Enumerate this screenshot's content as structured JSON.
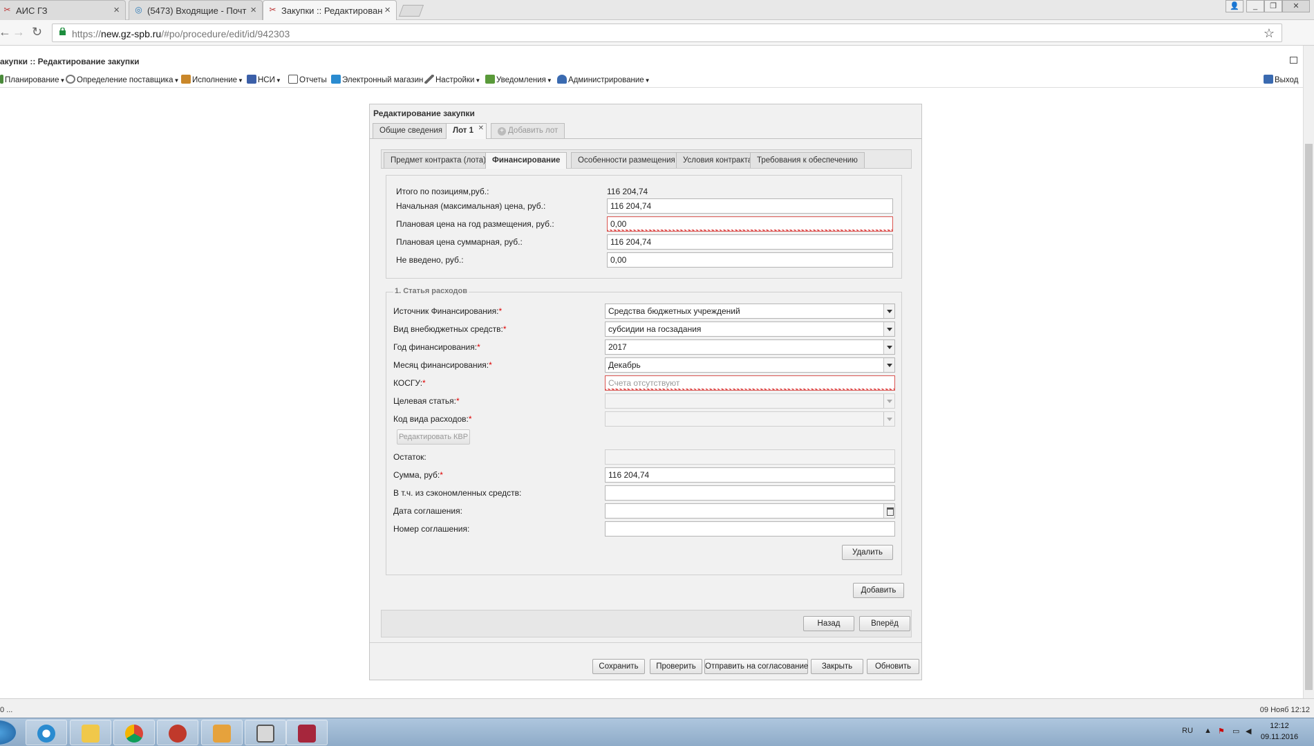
{
  "browser": {
    "tabs": [
      {
        "title": "АИС ГЗ",
        "icon": "ais-favicon"
      },
      {
        "title": "(5473) Входящие - Почт",
        "icon": "mail-favicon"
      },
      {
        "title": "Закупки :: Редактирован",
        "icon": "ais-favicon"
      }
    ],
    "url_scheme": "https://",
    "url_host": "new.gz-spb.ru",
    "url_path": "/#po/procedure/edit/id/942303"
  },
  "app": {
    "title": "акупки :: Редактирование закупки",
    "menu": [
      {
        "label": "Планирование",
        "icon": "planning-icon",
        "color": "#4a8a3a"
      },
      {
        "label": "Определение поставщика",
        "icon": "supplier-icon",
        "color": "#777777"
      },
      {
        "label": "Исполнение",
        "icon": "execution-icon",
        "color": "#c9872a"
      },
      {
        "label": "НСИ",
        "icon": "book-icon",
        "color": "#3b5fa8"
      },
      {
        "label": "Отчеты",
        "icon": "reports-icon",
        "color": "#555555"
      },
      {
        "label": "Электронный магазин",
        "icon": "cart-icon",
        "color": "#2a8bd0"
      },
      {
        "label": "Настройки",
        "icon": "wrench-icon",
        "color": "#666666"
      },
      {
        "label": "Уведомления",
        "icon": "notifications-icon",
        "color": "#5a9a3a"
      },
      {
        "label": "Администрирование",
        "icon": "admin-icon",
        "color": "#3a6ab0"
      }
    ],
    "logout": "Выход"
  },
  "window": {
    "title": "Редактирование закупки",
    "lot_tabs": [
      "Общие сведения",
      "Лот 1",
      "Добавить лот"
    ],
    "sub_tabs": [
      "Предмет контракта (лота)",
      "Финансирование",
      "Особенности размещения",
      "Условия контракта",
      "Требования к обеспечению"
    ],
    "active_sub_tab": "Финансирование"
  },
  "totals": {
    "items_total_label": "Итого по позициям,руб.:",
    "items_total_value": "116 204,74",
    "nmc_label": "Начальная (максимальная) цена, руб.:",
    "nmc_value": "116 204,74",
    "plan_year_label": "Плановая цена на год размещения, руб.:",
    "plan_year_value": "0,00",
    "plan_sum_label": "Плановая цена суммарная, руб.:",
    "plan_sum_value": "116 204,74",
    "not_entered_label": "Не введено, руб.:",
    "not_entered_value": "0,00"
  },
  "expenses": {
    "legend": "1. Статья расходов",
    "source_label": "Источник Финансирования:",
    "source_value": "Средства бюджетных учреждений",
    "kind_label": "Вид внебюджетных средств:",
    "kind_value": "субсидии на госзадания",
    "year_label": "Год финансирования:",
    "year_value": "2017",
    "month_label": "Месяц финансирования:",
    "month_value": "Декабрь",
    "kosgu_label": "КОСГУ:",
    "kosgu_placeholder": "Счета отсутствуют",
    "target_label": "Целевая статья:",
    "target_value": "",
    "kvr_label": "Код вида расходов:",
    "kvr_value": "",
    "edit_kvr_button": "Редактировать КВР",
    "rest_label": "Остаток:",
    "rest_value": "",
    "sum_label": "Сумма, руб:",
    "sum_value": "116 204,74",
    "saved_label": "В т.ч. из сэкономленных средств:",
    "saved_value": "",
    "agreement_date_label": "Дата соглашения:",
    "agreement_date_value": "",
    "agreement_number_label": "Номер соглашения:",
    "agreement_number_value": "",
    "delete_button": "Удалить",
    "required_mark": "*"
  },
  "actions": {
    "add": "Добавить",
    "back": "Назад",
    "forward": "Вперёд",
    "save": "Сохранить",
    "check": "Проверить",
    "send": "Отправить на согласование",
    "close": "Закрыть",
    "refresh": "Обновить"
  },
  "status": {
    "left": "0 ...",
    "right": "09 Нояб 12:12"
  },
  "taskbar": {
    "lang": "RU",
    "time": "12:12",
    "date": "09.11.2016"
  },
  "colors": {
    "error": "#d9534f",
    "required": "#dd0000",
    "window_bg": "#f1f1f1"
  }
}
